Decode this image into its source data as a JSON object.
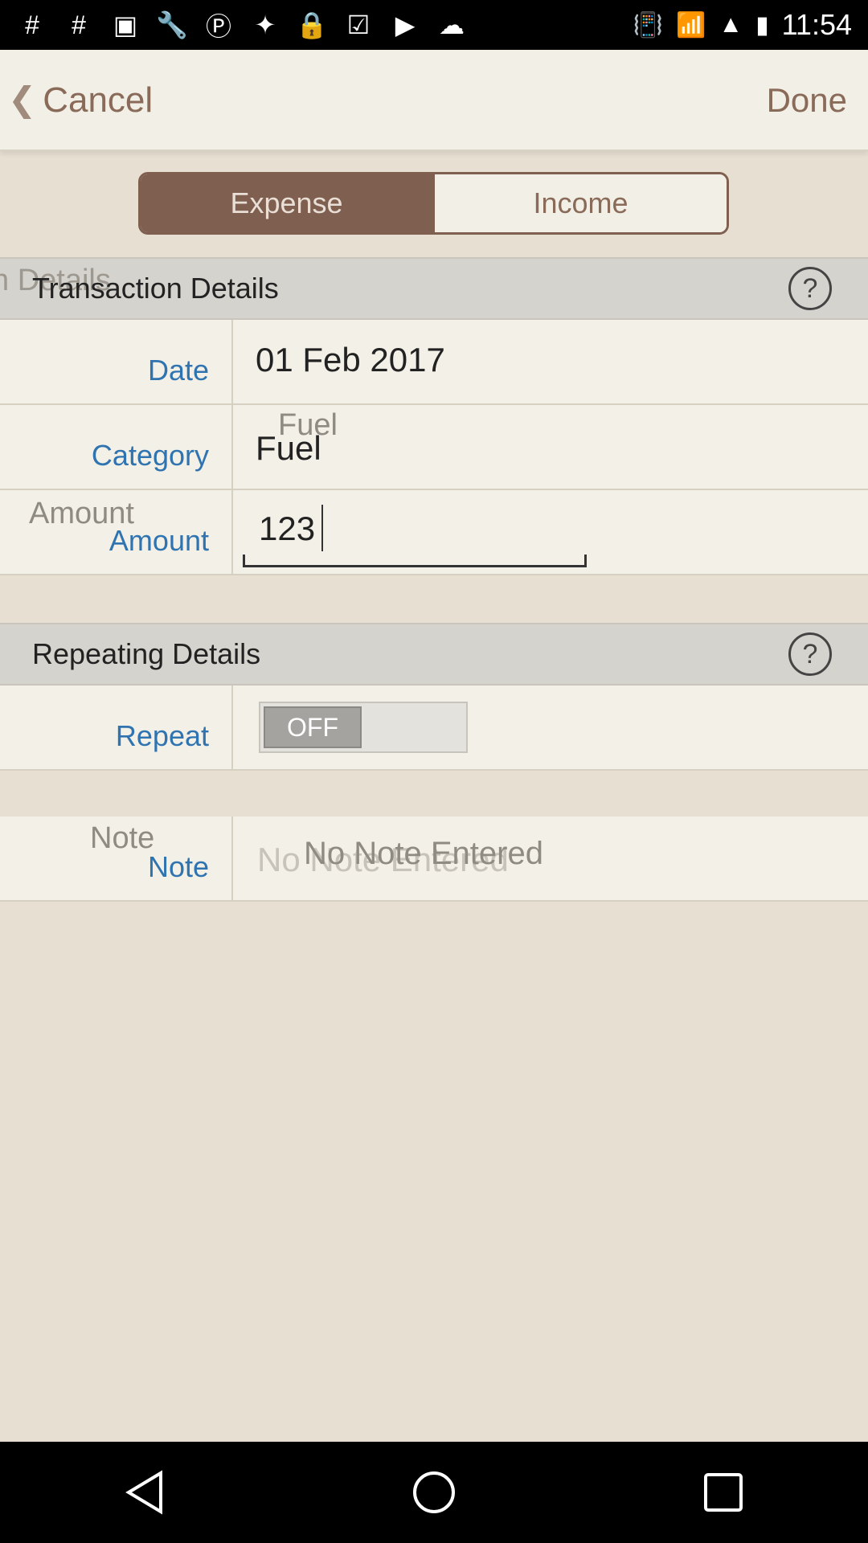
{
  "status_bar": {
    "time": "11:54",
    "icons": [
      "hashtag-icon",
      "hashtag-icon",
      "notification-icon",
      "wrench-icon",
      "circle-p-icon",
      "satellite-icon",
      "lock-icon",
      "inbox-check-icon",
      "play-store-icon",
      "cloud-icon",
      "vibrate-icon",
      "wifi-icon",
      "signal-icon",
      "battery-icon"
    ]
  },
  "header": {
    "back_label": "Cancel",
    "done_label": "Done"
  },
  "segmented": {
    "expense": "Expense",
    "income": "Income",
    "selected": "Expense"
  },
  "transaction": {
    "title": "Transaction Details",
    "ghost_title": "n Details",
    "rows": {
      "date": {
        "label": "Date",
        "value": "01 Feb 2017"
      },
      "category": {
        "label": "Category",
        "value": "Fuel",
        "ghost": "Fuel"
      },
      "amount": {
        "label": "Amount",
        "value": "123",
        "ghost": "Amount"
      }
    }
  },
  "repeating": {
    "title": "Repeating Details",
    "repeat_label": "Repeat",
    "toggle_state": "OFF"
  },
  "note": {
    "label": "Note",
    "ghost_label": "Note",
    "placeholder": "No Note Entered",
    "ghost_placeholder": "No Note Entered"
  },
  "colors": {
    "accent": "#7f5f4f",
    "label_blue": "#2f74b0",
    "header_bg": "#f2efe6",
    "section_bg": "#d5d3cd"
  }
}
